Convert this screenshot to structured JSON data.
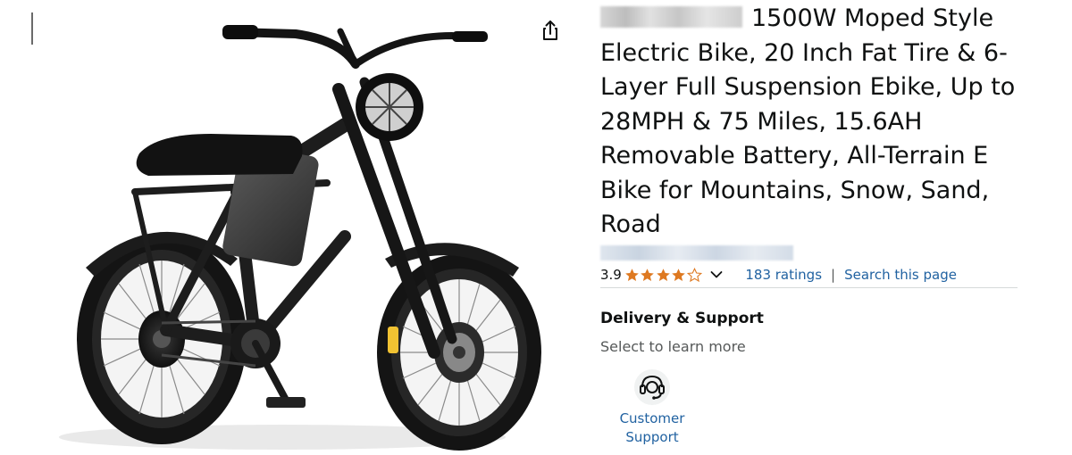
{
  "product": {
    "title": "1500W Moped Style Electric Bike, 20 Inch Fat Tire & 6-Layer Full Suspension Ebike, Up to 28MPH & 75 Miles, 15.6AH Removable Battery, All-Terrain E Bike for Mountains, Snow, Sand, Road"
  },
  "rating": {
    "value": "3.9",
    "stars": 3.9,
    "max_stars": 5,
    "ratings_text": "183 ratings",
    "separator": "|",
    "search_link": "Search this page"
  },
  "delivery": {
    "heading": "Delivery & Support",
    "subtext": "Select to learn more",
    "support_line1": "Customer",
    "support_line2": "Support"
  },
  "colors": {
    "link": "#2162a1",
    "star": "#de7921",
    "text": "#0f1111",
    "muted": "#565959",
    "divider": "#d5d9d9"
  },
  "icons": {
    "share": "share-icon",
    "chevron": "chevron-down-icon",
    "support": "customer-support-headset-icon",
    "star_full": "star-filled-icon",
    "star_empty": "star-empty-icon"
  }
}
